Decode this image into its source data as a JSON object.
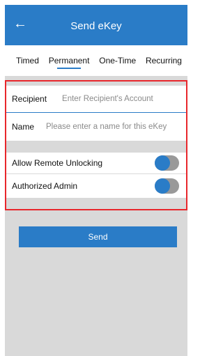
{
  "header": {
    "back_icon": "arrow-left-icon",
    "title": "Send eKey"
  },
  "tabs": [
    {
      "label": "Timed",
      "active": false
    },
    {
      "label": "Permanent",
      "active": true
    },
    {
      "label": "One-Time",
      "active": false
    },
    {
      "label": "Recurring",
      "active": false
    }
  ],
  "form": {
    "recipient": {
      "label": "Recipient",
      "placeholder": "Enter Recipient's Account"
    },
    "name": {
      "label": "Name",
      "placeholder": "Please enter a name for this eKey"
    }
  },
  "toggles": {
    "remote_unlock": {
      "label": "Allow Remote Unlocking",
      "on": true
    },
    "authorized_admin": {
      "label": "Authorized Admin",
      "on": true
    }
  },
  "send_button": {
    "label": "Send"
  },
  "colors": {
    "accent": "#2a7cc7",
    "highlight_border": "#e8262b",
    "background": "#d9d9d9"
  }
}
